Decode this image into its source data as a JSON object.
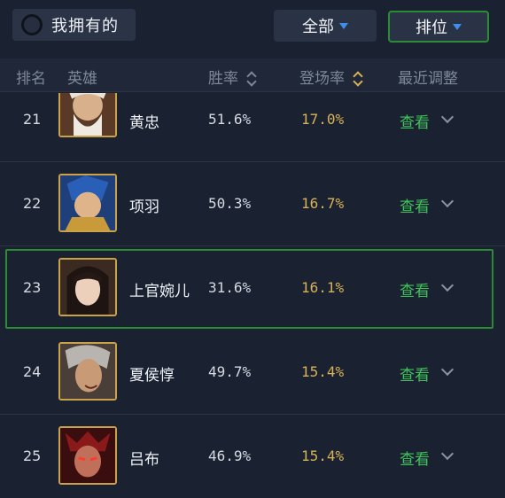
{
  "topbar": {
    "owned_label": "我拥有的",
    "filter_all_label": "全部",
    "filter_rank_label": "排位"
  },
  "header": {
    "rank": "排名",
    "hero": "英雄",
    "win_rate": "胜率",
    "appearance_rate": "登场率",
    "recent_adjust": "最近调整"
  },
  "colors": {
    "background": "#1a2131",
    "accent_green": "#3fc25a",
    "accent_gold": "#d8b257",
    "highlight_border": "#2e8b35"
  },
  "rows": [
    {
      "rank": "21",
      "name": "黄忠",
      "win_rate": "51.6%",
      "appearance_rate": "17.0%",
      "action": "查看"
    },
    {
      "rank": "22",
      "name": "项羽",
      "win_rate": "50.3%",
      "appearance_rate": "16.7%",
      "action": "查看"
    },
    {
      "rank": "23",
      "name": "上官婉儿",
      "win_rate": "31.6%",
      "appearance_rate": "16.1%",
      "action": "查看"
    },
    {
      "rank": "24",
      "name": "夏侯惇",
      "win_rate": "49.7%",
      "appearance_rate": "15.4%",
      "action": "查看"
    },
    {
      "rank": "25",
      "name": "吕布",
      "win_rate": "46.9%",
      "appearance_rate": "15.4%",
      "action": "查看"
    }
  ]
}
